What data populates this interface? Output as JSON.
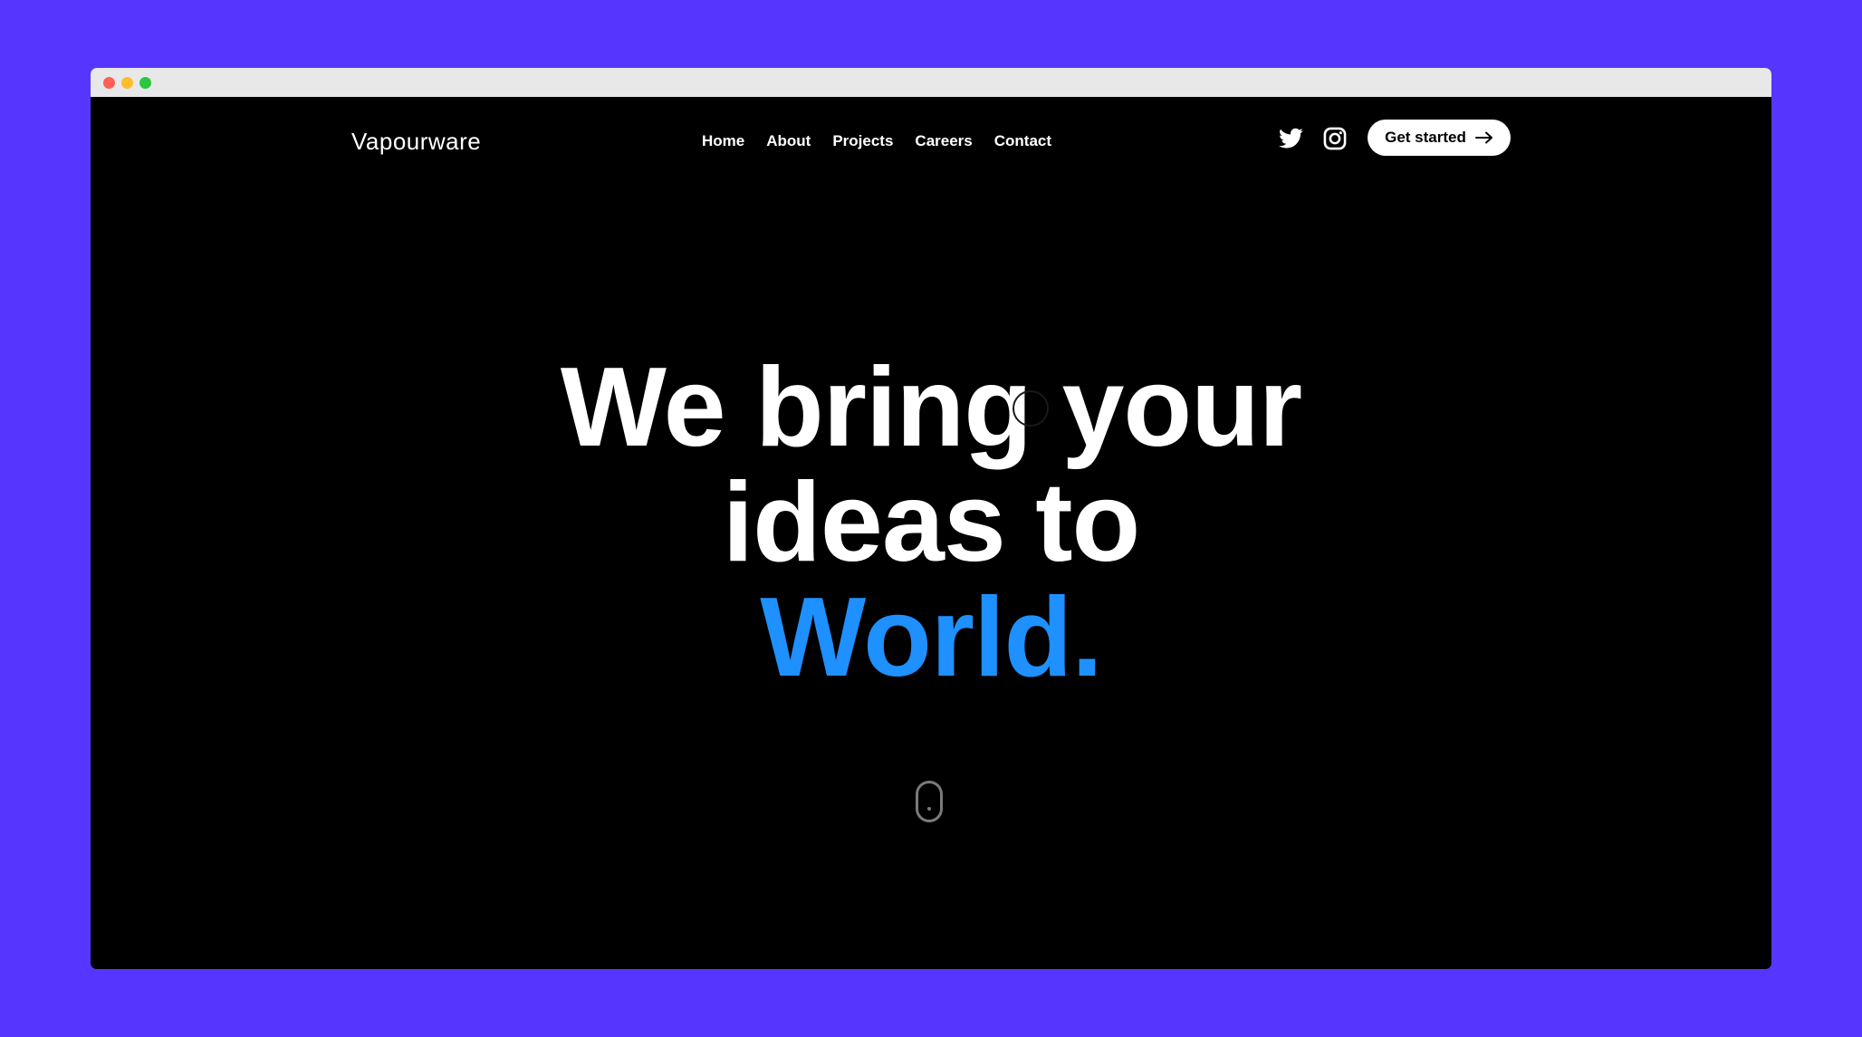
{
  "window": {
    "controls": [
      "close",
      "minimize",
      "maximize"
    ]
  },
  "header": {
    "logo": "Vapourware",
    "nav": [
      {
        "label": "Home"
      },
      {
        "label": "About"
      },
      {
        "label": "Projects"
      },
      {
        "label": "Careers"
      },
      {
        "label": "Contact"
      }
    ],
    "social": [
      {
        "icon": "twitter-icon"
      },
      {
        "icon": "instagram-icon"
      }
    ],
    "cta_label": "Get started",
    "cta_icon": "arrow-right-icon"
  },
  "hero": {
    "line1": "We bring your",
    "line2": "ideas to",
    "line3": "World."
  },
  "colors": {
    "background": "#5636FF",
    "page": "#000000",
    "accent": "#1E90FF",
    "text": "#FFFFFF"
  },
  "scroll_indicator": {
    "icon": "mouse-scroll-icon"
  }
}
